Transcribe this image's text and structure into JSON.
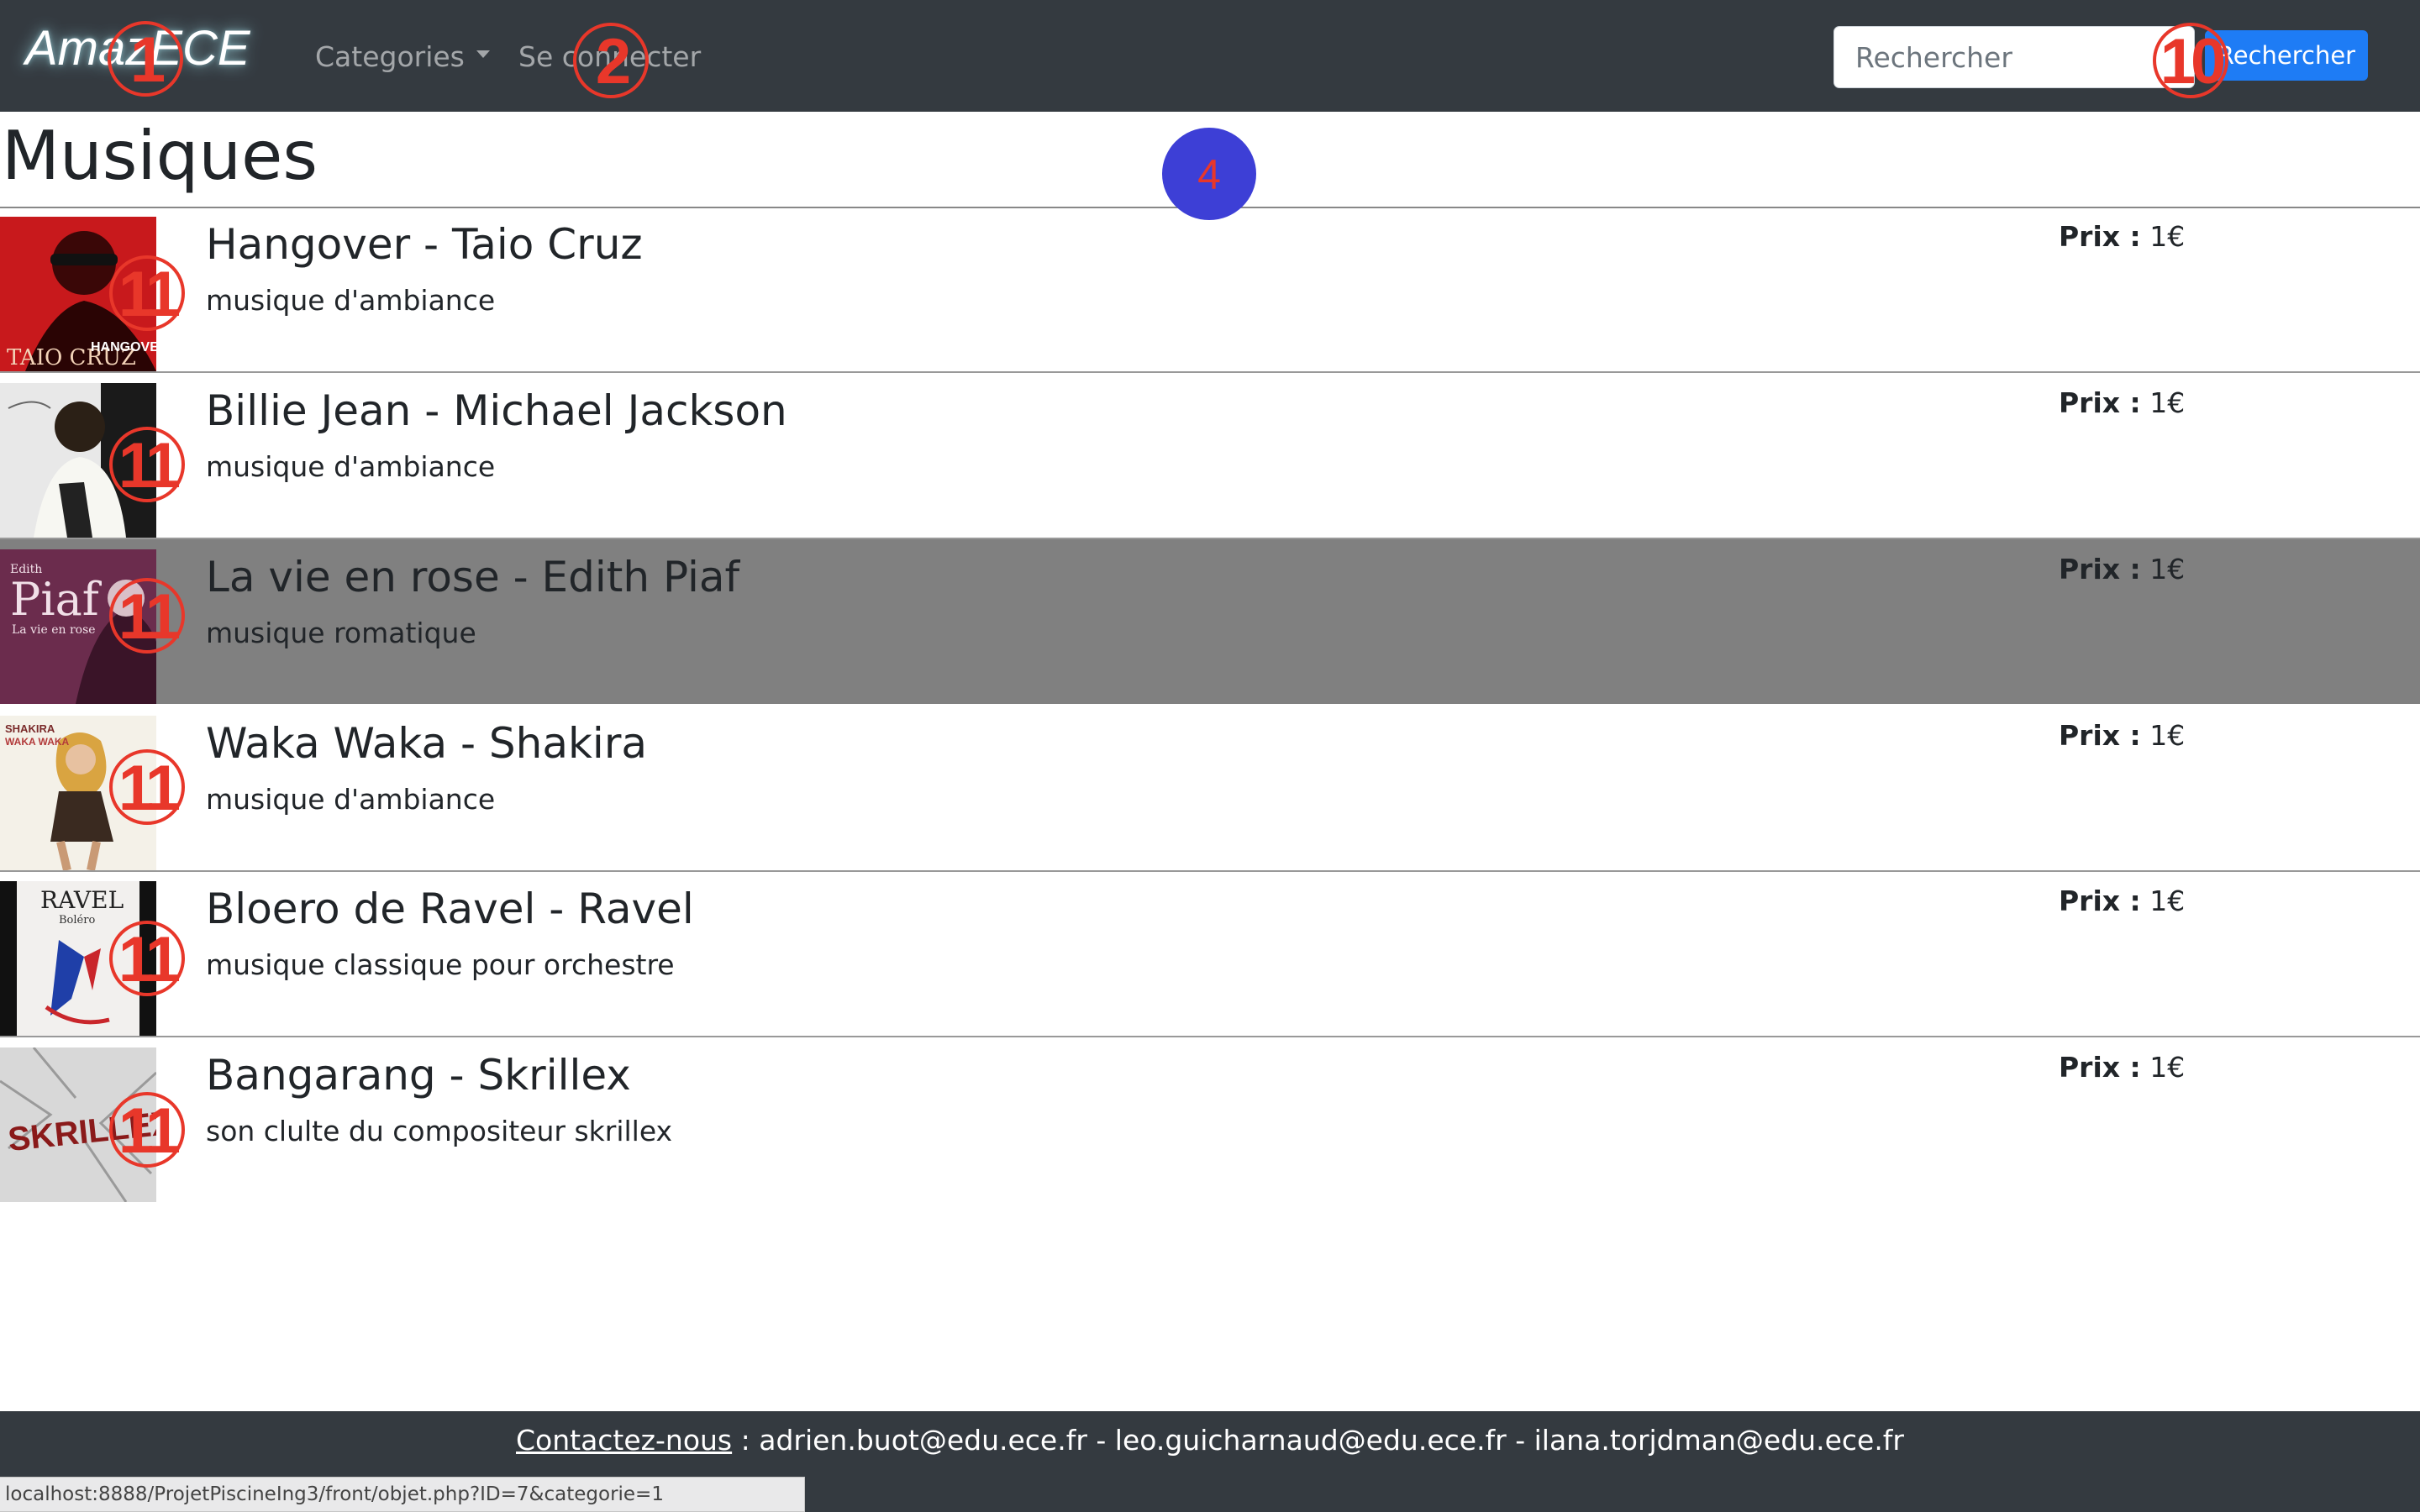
{
  "navbar": {
    "brand": "AmazECE",
    "categories_label": "Categories",
    "login_label": "Se connecter",
    "search_placeholder": "Rechercher",
    "search_button": "Rechercher"
  },
  "page_title": "Musiques",
  "items": [
    {
      "title": "Hangover - Taio Cruz",
      "description": "musique d'ambiance",
      "price_label": "Prix :",
      "price": "1€",
      "cover_text_top": "TAIO CRUZ",
      "cover_text_bottom": "HANGOVER",
      "cover_color": "#c8191c"
    },
    {
      "title": "Billie Jean - Michael Jackson",
      "description": "musique d'ambiance",
      "price_label": "Prix :",
      "price": "1€",
      "cover_color": "#2b2b2b"
    },
    {
      "title": "La vie en rose - Edith Piaf",
      "description": "musique romatique",
      "price_label": "Prix :",
      "price": "1€",
      "cover_text_top": "Edith",
      "cover_text_main": "Piaf",
      "cover_text_bottom": "La vie en rose",
      "cover_color": "#6b2c4d"
    },
    {
      "title": "Waka Waka - Shakira",
      "description": "musique d'ambiance",
      "price_label": "Prix :",
      "price": "1€",
      "cover_text_top": "SHAKIRA",
      "cover_text_bottom": "WAKA WAKA",
      "cover_color": "#f4f1e8"
    },
    {
      "title": "Bloero de Ravel - Ravel",
      "description": "musique classique pour orchestre",
      "price_label": "Prix :",
      "price": "1€",
      "cover_text_top": "RAVEL",
      "cover_text_bottom": "Boléro",
      "cover_color": "#f2f0ee"
    },
    {
      "title": "Bangarang - Skrillex",
      "description": "son clulte du compositeur skrillex",
      "price_label": "Prix :",
      "price": "1€",
      "cover_text_top": "SKRILLEX",
      "cover_color": "#d8d8d8"
    }
  ],
  "markers": {
    "brand": "1",
    "login": "2",
    "cursor": "4",
    "search": "10",
    "item": "11"
  },
  "footer": {
    "contact_label": "Contactez-nous",
    "emails": " : adrien.buot@edu.ece.fr - leo.guicharnaud@edu.ece.fr - ilana.torjdman@edu.ece.fr"
  },
  "status_bar": {
    "url": "localhost:8888/ProjetPiscineIng3/front/objet.php?ID=7&categorie=1"
  },
  "colors": {
    "navbar": "#343a40",
    "accent": "#1e7cf5",
    "hover_row": "#808080",
    "marker": "#e8372a"
  }
}
